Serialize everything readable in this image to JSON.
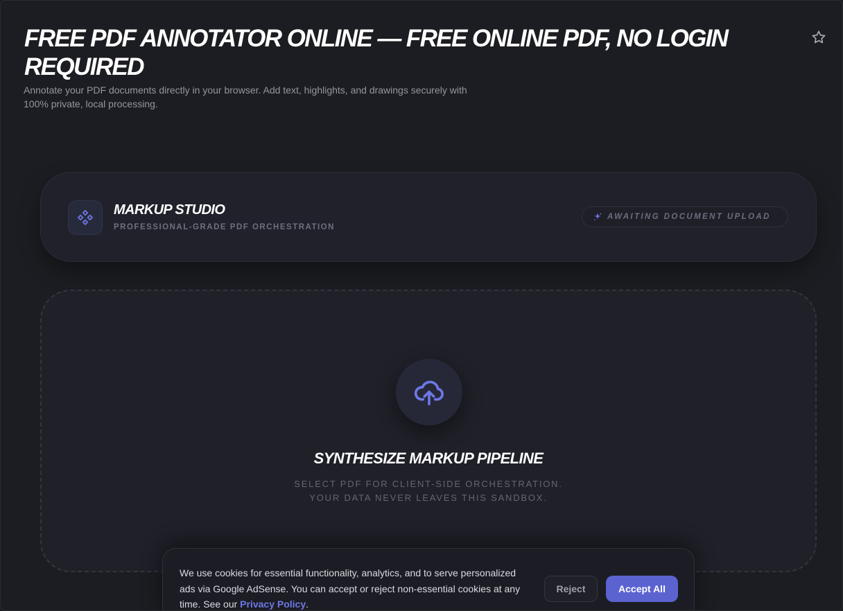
{
  "page": {
    "title": "FREE PDF ANNOTATOR ONLINE — FREE ONLINE PDF, NO LOGIN REQUIRED",
    "subtitle": "Annotate your PDF documents directly in your browser. Add text, highlights, and drawings securely with 100% private, local processing.",
    "favorite_icon": "star-icon"
  },
  "studio": {
    "logo_icon": "diamond-cluster-icon",
    "name": "MARKUP STUDIO",
    "tagline": "PROFESSIONAL-GRADE PDF ORCHESTRATION",
    "status_icon": "sparkle-icon",
    "status": "AWAITING DOCUMENT UPLOAD"
  },
  "dropzone": {
    "icon": "cloud-upload-icon",
    "title": "SYNTHESIZE MARKUP PIPELINE",
    "line1": "SELECT PDF FOR CLIENT-SIDE ORCHESTRATION.",
    "line2": "YOUR DATA NEVER LEAVES THIS SANDBOX."
  },
  "cookie": {
    "text_before": "We use cookies for essential functionality, analytics, and to serve personalized ads via Google AdSense. You can accept or reject non-essential cookies at any time. See our ",
    "link_label": "Privacy Policy",
    "text_after": ".",
    "reject_label": "Reject",
    "accept_label": "Accept All"
  },
  "colors": {
    "accent": "#5b63d0",
    "background": "#1c1d22",
    "card": "#20212a"
  }
}
